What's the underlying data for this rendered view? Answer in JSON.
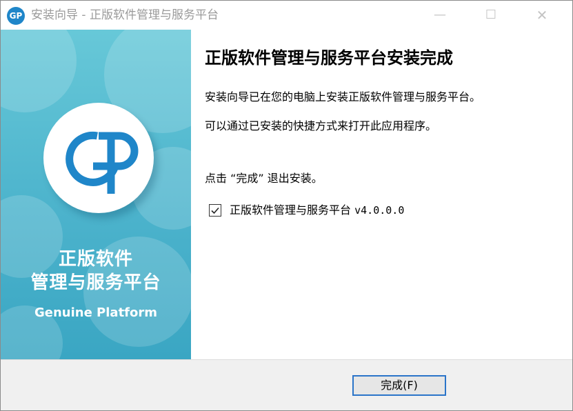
{
  "window": {
    "title": "安装向导 - 正版软件管理与服务平台",
    "app_icon_text": "GP",
    "minimize_glyph": "—",
    "maximize_glyph": "☐",
    "close_glyph": "✕"
  },
  "banner": {
    "line1": "正版软件",
    "line2": "管理与服务平台",
    "english": "Genuine Platform",
    "logo_icon": "gp-logo-icon"
  },
  "content": {
    "heading": "正版软件管理与服务平台安装完成",
    "para1": "安装向导已在您的电脑上安装正版软件管理与服务平台。",
    "para2": "可以通过已安装的快捷方式来打开此应用程序。",
    "para3": "点击 “完成” 退出安装。",
    "checkbox": {
      "label": "正版软件管理与服务平台",
      "version": "v4.0.0.0",
      "checked": true
    }
  },
  "footer": {
    "finish_label": "完成(F)"
  },
  "colors": {
    "banner_top": "#67c8d8",
    "banner_bottom": "#3aa6c3",
    "logo_blue": "#1f86c9",
    "button_border": "#2a74c9",
    "footer_bg": "#f0f0f0"
  }
}
